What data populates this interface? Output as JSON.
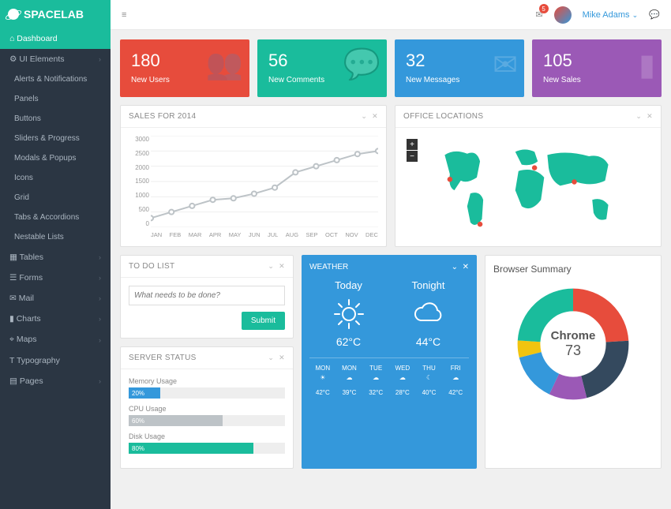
{
  "brand": "SPACELAB",
  "topbar": {
    "notif_count": "5",
    "username": "Mike Adams"
  },
  "sidebar": {
    "items": [
      {
        "label": "Dashboard",
        "icon": "⌂",
        "active": true
      },
      {
        "label": "UI Elements",
        "icon": "⚙",
        "expand": true
      },
      {
        "label": "Alerts & Notifications",
        "sub": true
      },
      {
        "label": "Panels",
        "sub": true
      },
      {
        "label": "Buttons",
        "sub": true
      },
      {
        "label": "Sliders & Progress",
        "sub": true
      },
      {
        "label": "Modals & Popups",
        "sub": true
      },
      {
        "label": "Icons",
        "sub": true
      },
      {
        "label": "Grid",
        "sub": true
      },
      {
        "label": "Tabs & Accordions",
        "sub": true
      },
      {
        "label": "Nestable Lists",
        "sub": true
      },
      {
        "label": "Tables",
        "icon": "▦",
        "expand": true
      },
      {
        "label": "Forms",
        "icon": "☰",
        "expand": true
      },
      {
        "label": "Mail",
        "icon": "✉",
        "expand": true
      },
      {
        "label": "Charts",
        "icon": "▮",
        "expand": true
      },
      {
        "label": "Maps",
        "icon": "⌖",
        "expand": true
      },
      {
        "label": "Typography",
        "icon": "T"
      },
      {
        "label": "Pages",
        "icon": "▤",
        "expand": true
      }
    ]
  },
  "cards": [
    {
      "num": "180",
      "label": "New Users",
      "color": "red"
    },
    {
      "num": "56",
      "label": "New Comments",
      "color": "green"
    },
    {
      "num": "32",
      "label": "New Messages",
      "color": "blue"
    },
    {
      "num": "105",
      "label": "New Sales",
      "color": "purple"
    }
  ],
  "sales": {
    "title": "SALES FOR 2014"
  },
  "chart_data": {
    "type": "line",
    "title": "SALES FOR 2014",
    "categories": [
      "JAN",
      "FEB",
      "MAR",
      "APR",
      "MAY",
      "JUN",
      "JUL",
      "AUG",
      "SEP",
      "OCT",
      "NOV",
      "DEC"
    ],
    "values": [
      300,
      500,
      700,
      900,
      950,
      1100,
      1300,
      1800,
      2000,
      2200,
      2400,
      2500
    ],
    "ylim": [
      0,
      3000
    ],
    "yticks": [
      "3000",
      "2500",
      "2000",
      "1500",
      "1000",
      "500",
      "0"
    ]
  },
  "map": {
    "title": "OFFICE LOCATIONS"
  },
  "todo": {
    "title": "TO DO LIST",
    "placeholder": "What needs to be done?",
    "submit": "Submit"
  },
  "server": {
    "title": "SERVER STATUS",
    "items": [
      {
        "label": "Memory Usage",
        "val": "20%",
        "pct": 20,
        "color": "#3498db"
      },
      {
        "label": "CPU Usage",
        "val": "60%",
        "pct": 60,
        "color": "#bdc3c7"
      },
      {
        "label": "Disk Usage",
        "val": "80%",
        "pct": 80,
        "color": "#1abc9c"
      }
    ]
  },
  "weather": {
    "title": "WEATHER",
    "today": {
      "label": "Today",
      "temp": "62°C"
    },
    "tonight": {
      "label": "Tonight",
      "temp": "44°C"
    },
    "days": [
      {
        "d": "MON",
        "t": "42°C"
      },
      {
        "d": "MON",
        "t": "39°C"
      },
      {
        "d": "TUE",
        "t": "32°C"
      },
      {
        "d": "WED",
        "t": "28°C"
      },
      {
        "d": "THU",
        "t": "40°C"
      },
      {
        "d": "FRI",
        "t": "42°C"
      }
    ]
  },
  "browser": {
    "title": "Browser Summary",
    "center_name": "Chrome",
    "center_val": "73",
    "segments": [
      {
        "color": "#e74c3c",
        "pct": 24
      },
      {
        "color": "#34495e",
        "pct": 22
      },
      {
        "color": "#9b59b6",
        "pct": 11
      },
      {
        "color": "#3498db",
        "pct": 14
      },
      {
        "color": "#f1c40f",
        "pct": 5
      },
      {
        "color": "#1abc9c",
        "pct": 24
      }
    ]
  }
}
